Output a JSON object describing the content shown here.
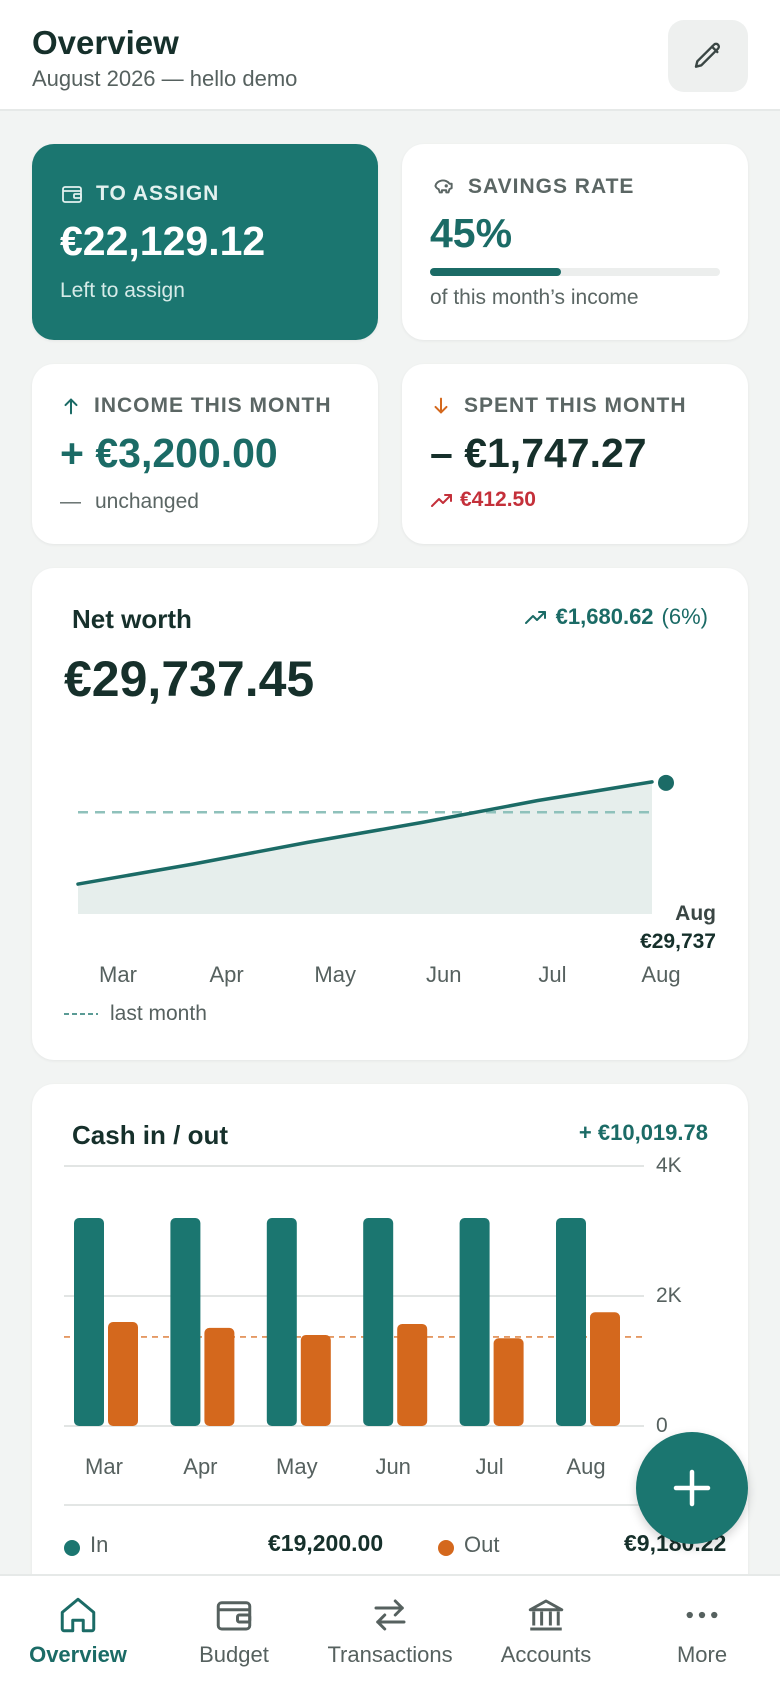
{
  "header": {
    "title": "Overview",
    "subtitle": "August 2026 — hello demo",
    "edit_icon": "pencil-icon"
  },
  "kpis": {
    "to_assign": {
      "label": "TO ASSIGN",
      "value": "€22,129.12",
      "sub": "Left to assign",
      "icon": "wallet-icon"
    },
    "savings_rate": {
      "label": "SAVINGS RATE",
      "value": "45%",
      "progress": 0.45,
      "sub": "of this month’s income",
      "icon": "piggy-bank-icon"
    },
    "income": {
      "label": "INCOME THIS MONTH",
      "value": "+ €3,200.00",
      "sub_icon": "—",
      "sub": "unchanged",
      "icon": "arrow-up-icon"
    },
    "spent": {
      "label": "SPENT THIS MONTH",
      "value": "– €1,747.27",
      "sub": "€412.50",
      "sub_icon": "trend-up-icon",
      "icon": "arrow-down-icon"
    }
  },
  "net_worth": {
    "title": "Net worth",
    "value": "€29,737.45",
    "change": "€1,680.62",
    "change_pct": "(6%)",
    "end_label_month": "Aug",
    "end_label_value": "€29,737",
    "legend": "last month",
    "colors": {
      "line": "#1b6b66",
      "area": "#e6eeec",
      "dashed": "#8fc1bb"
    }
  },
  "cash_flow": {
    "title": "Cash in / out",
    "total": "+ €10,019.78",
    "legend_in_label": "In",
    "legend_in_value": "€19,200.00",
    "legend_out_label": "Out",
    "legend_out_value": "€9,180.22",
    "colors": {
      "in": "#1b7670",
      "out": "#d4681d"
    }
  },
  "chart_data": [
    {
      "type": "area",
      "title": "Net worth",
      "x": [
        "Mar",
        "Apr",
        "May",
        "Jun",
        "Jul",
        "Aug"
      ],
      "series": [
        {
          "values": [
            24100,
            25200,
            26400,
            27500,
            28700,
            29737
          ]
        }
      ],
      "reference_line": {
        "name": "last month",
        "value": 28056.83
      },
      "ylim": [
        23000,
        30500
      ],
      "grid": false
    },
    {
      "type": "bar",
      "title": "Cash in / out",
      "categories": [
        "Mar",
        "Apr",
        "May",
        "Jun",
        "Jul",
        "Aug"
      ],
      "series": [
        {
          "name": "In",
          "values": [
            3200,
            3200,
            3200,
            3200,
            3200,
            3200
          ]
        },
        {
          "name": "Out",
          "values": [
            1600,
            1510,
            1400,
            1570,
            1350,
            1750
          ]
        }
      ],
      "reference_line": {
        "value": 1370
      },
      "yticks": [
        "0",
        "2K",
        "4K"
      ],
      "ylim": [
        0,
        4000
      ],
      "grid": true
    }
  ],
  "fab": {
    "icon": "plus-icon"
  },
  "nav": [
    {
      "label": "Overview",
      "icon": "home-icon",
      "active": true
    },
    {
      "label": "Budget",
      "icon": "wallet-icon",
      "active": false
    },
    {
      "label": "Transactions",
      "icon": "transfer-icon",
      "active": false
    },
    {
      "label": "Accounts",
      "icon": "bank-icon",
      "active": false
    },
    {
      "label": "More",
      "icon": "more-icon",
      "active": false
    }
  ]
}
